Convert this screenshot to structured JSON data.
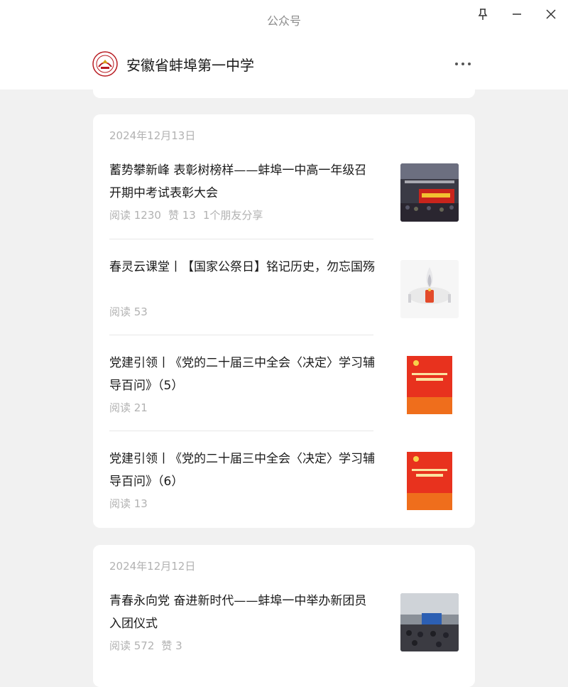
{
  "window": {
    "title": "公众号"
  },
  "account": {
    "name": "安徽省蚌埠第一中学",
    "logo_icon": "school-emblem-icon"
  },
  "groups": [
    {
      "date": "2024年12月13日",
      "articles": [
        {
          "title": "蓄势攀新峰 表彰树榜样——蚌埠一中高一年级召开期中考试表彰大会",
          "reads": "阅读 1230",
          "likes": "赞 13",
          "shares": "1个朋友分享",
          "thumb": "ceremony-hall-photo"
        },
        {
          "title": "春灵云课堂丨【国家公祭日】铭记历史，勿忘国殇",
          "reads": "阅读 53",
          "thumb": "candle-photo"
        },
        {
          "title": "党建引领丨《党的二十届三中全会〈决定〉学习辅导百问》（5）",
          "reads": "阅读 21",
          "thumb": "red-book-cover"
        },
        {
          "title": "党建引领丨《党的二十届三中全会〈决定〉学习辅导百问》（6）",
          "reads": "阅读 13",
          "thumb": "red-book-cover"
        }
      ]
    },
    {
      "date": "2024年12月12日",
      "articles": [
        {
          "title": "青春永向党 奋进新时代——蚌埠一中举办新团员入团仪式",
          "reads": "阅读 572",
          "likes": "赞 3",
          "thumb": "auditorium-photo"
        }
      ]
    }
  ],
  "colors": {
    "background": "#f1f1f1",
    "card": "#ffffff",
    "muted_text": "#b2b2b2",
    "title_text": "#1a1a1a",
    "party_red": "#e8321e"
  }
}
